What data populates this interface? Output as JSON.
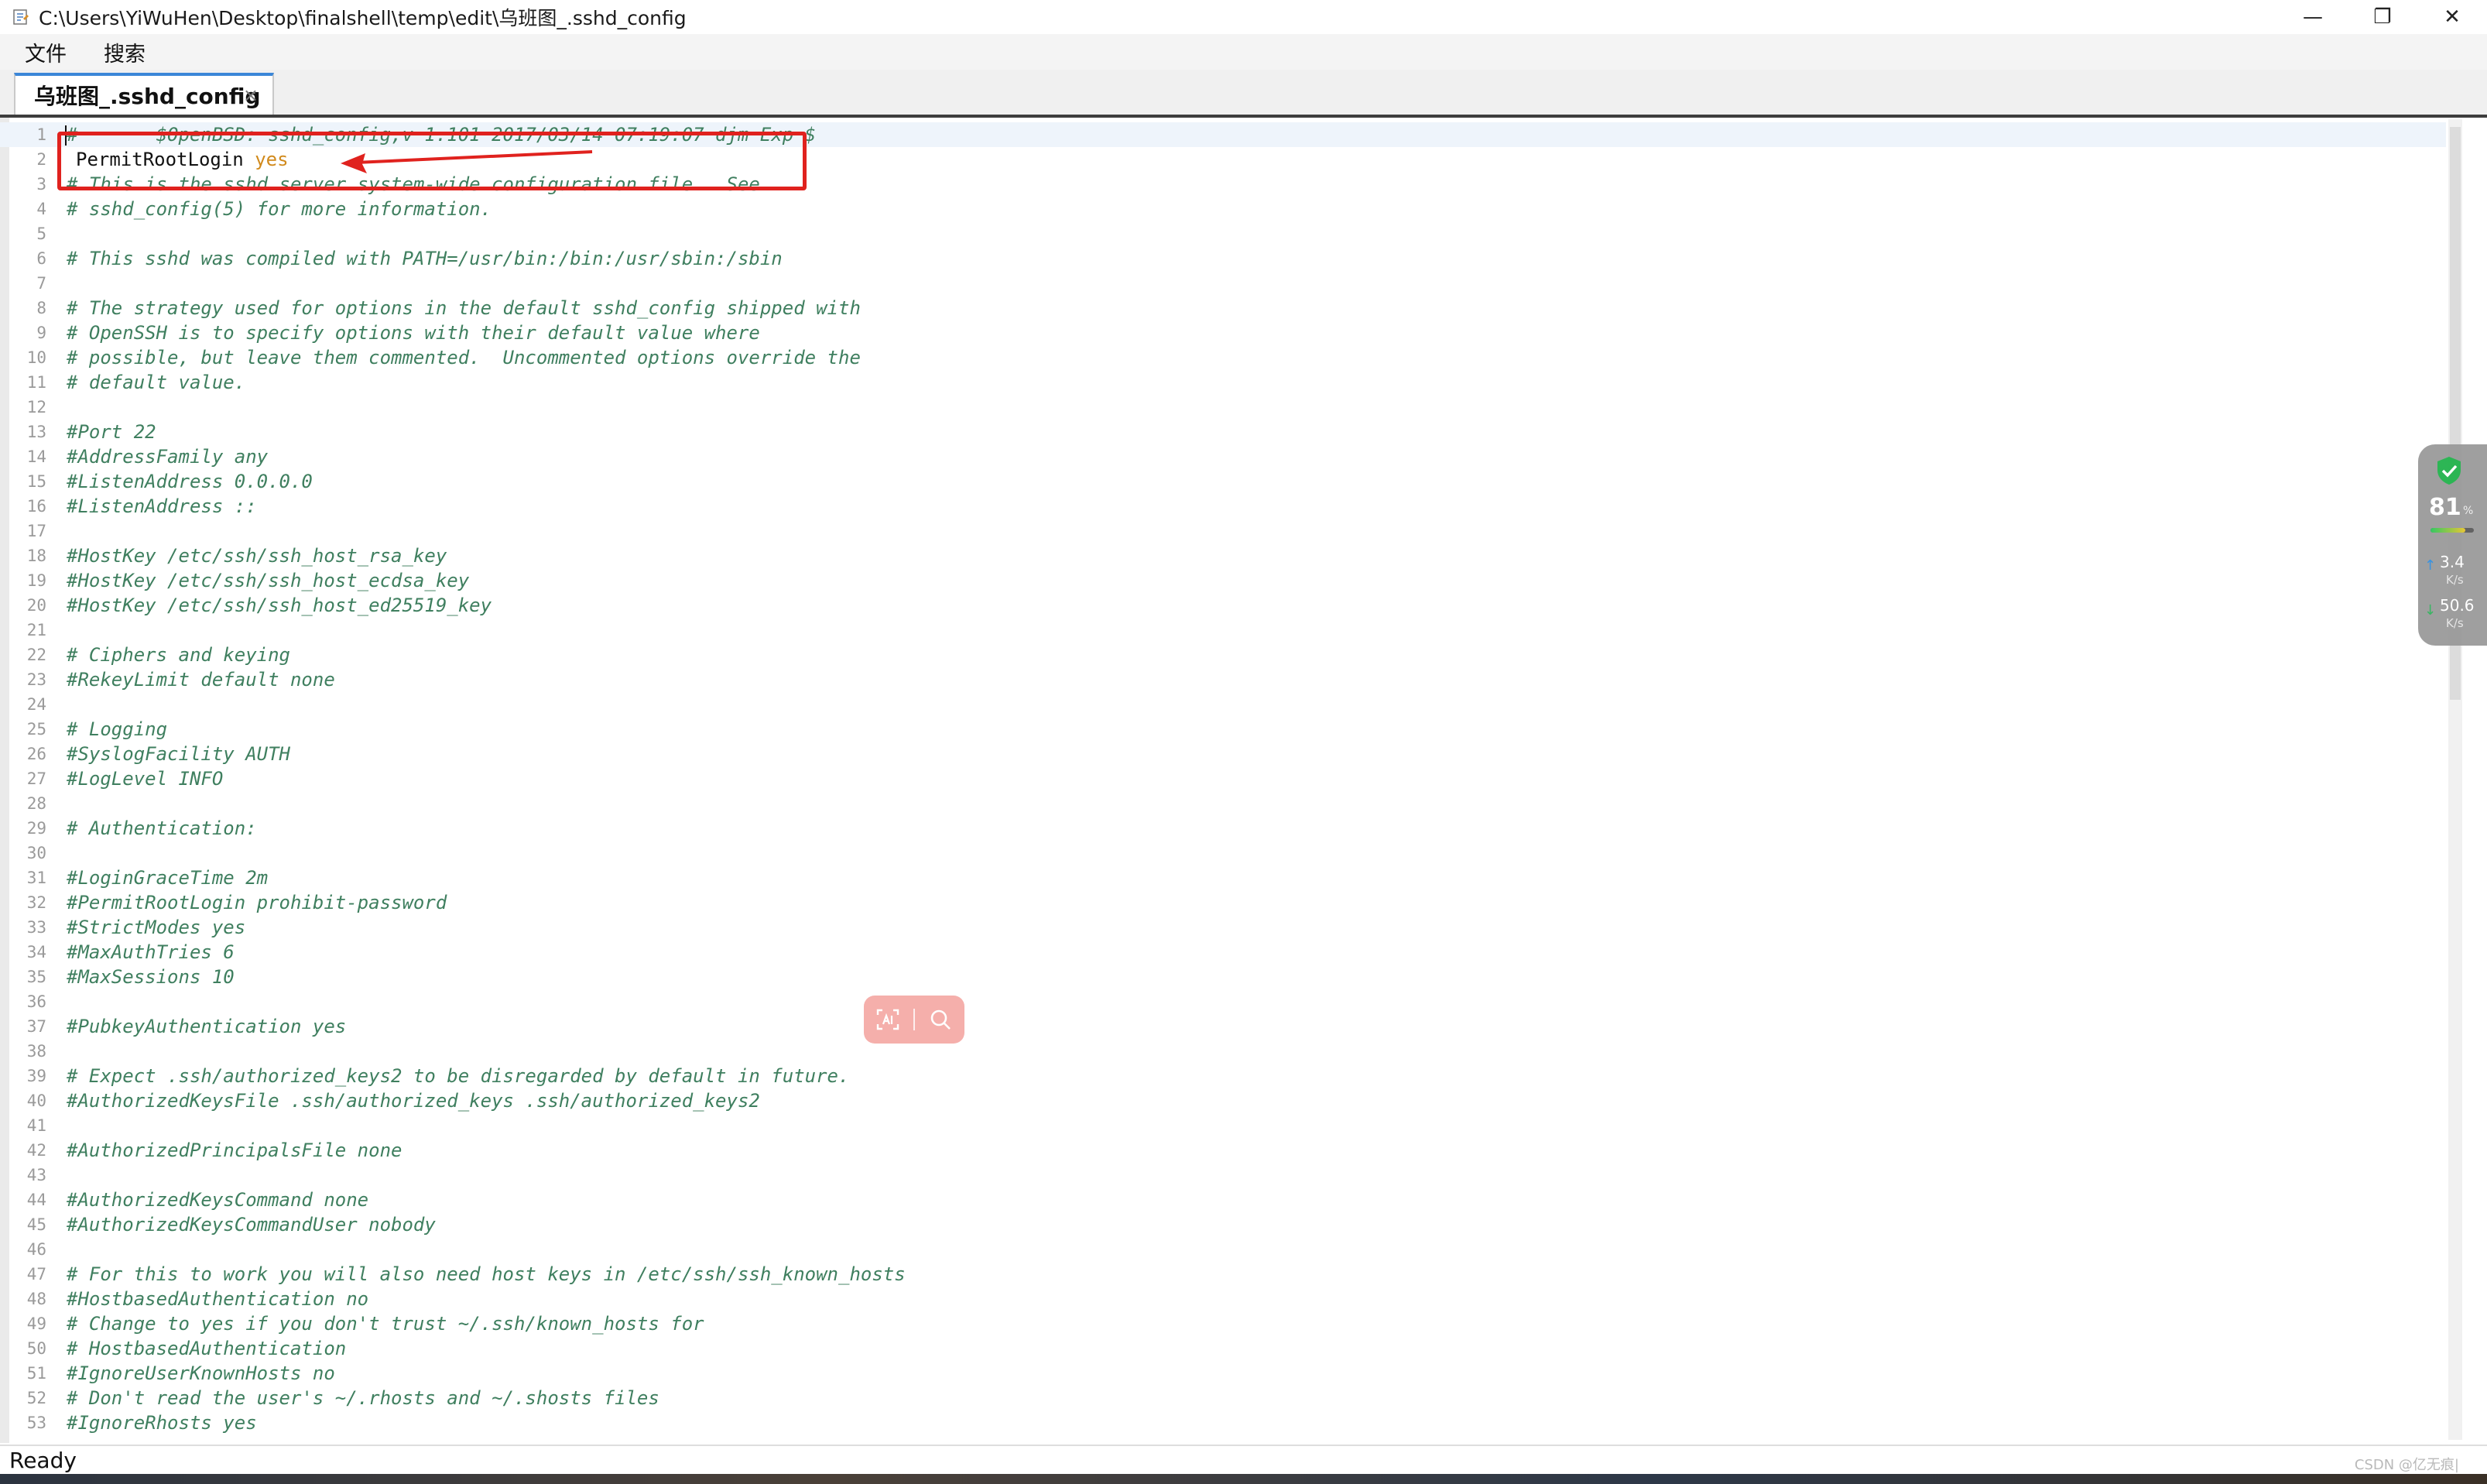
{
  "window": {
    "title": "C:\\Users\\YiWuHen\\Desktop\\finalshell\\temp\\edit\\乌班图_.sshd_config",
    "minimize": "—",
    "maximize": "❐",
    "close": "✕"
  },
  "menu": [
    "文件",
    "搜索"
  ],
  "tab": {
    "label": "乌班图_.sshd_config",
    "close": "×"
  },
  "editor": {
    "lines": [
      {
        "n": "1",
        "text": "#\t$OpenBSD: sshd_config,v 1.101 2017/03/14 07:19:07 djm Exp $"
      },
      {
        "n": "2",
        "text": "PermitRootLogin ",
        "value": "yes"
      },
      {
        "n": "3",
        "text": "# This is the sshd server system-wide configuration file.  See"
      },
      {
        "n": "4",
        "text": "# sshd_config(5) for more information."
      },
      {
        "n": "5",
        "text": ""
      },
      {
        "n": "6",
        "text": "# This sshd was compiled with PATH=/usr/bin:/bin:/usr/sbin:/sbin"
      },
      {
        "n": "7",
        "text": ""
      },
      {
        "n": "8",
        "text": "# The strategy used for options in the default sshd_config shipped with"
      },
      {
        "n": "9",
        "text": "# OpenSSH is to specify options with their default value where"
      },
      {
        "n": "10",
        "text": "# possible, but leave them commented.  Uncommented options override the"
      },
      {
        "n": "11",
        "text": "# default value."
      },
      {
        "n": "12",
        "text": ""
      },
      {
        "n": "13",
        "text": "#Port 22"
      },
      {
        "n": "14",
        "text": "#AddressFamily any"
      },
      {
        "n": "15",
        "text": "#ListenAddress 0.0.0.0"
      },
      {
        "n": "16",
        "text": "#ListenAddress ::"
      },
      {
        "n": "17",
        "text": ""
      },
      {
        "n": "18",
        "text": "#HostKey /etc/ssh/ssh_host_rsa_key"
      },
      {
        "n": "19",
        "text": "#HostKey /etc/ssh/ssh_host_ecdsa_key"
      },
      {
        "n": "20",
        "text": "#HostKey /etc/ssh/ssh_host_ed25519_key"
      },
      {
        "n": "21",
        "text": ""
      },
      {
        "n": "22",
        "text": "# Ciphers and keying"
      },
      {
        "n": "23",
        "text": "#RekeyLimit default none"
      },
      {
        "n": "24",
        "text": ""
      },
      {
        "n": "25",
        "text": "# Logging"
      },
      {
        "n": "26",
        "text": "#SyslogFacility AUTH"
      },
      {
        "n": "27",
        "text": "#LogLevel INFO"
      },
      {
        "n": "28",
        "text": ""
      },
      {
        "n": "29",
        "text": "# Authentication:"
      },
      {
        "n": "30",
        "text": ""
      },
      {
        "n": "31",
        "text": "#LoginGraceTime 2m"
      },
      {
        "n": "32",
        "text": "#PermitRootLogin prohibit-password"
      },
      {
        "n": "33",
        "text": "#StrictModes yes"
      },
      {
        "n": "34",
        "text": "#MaxAuthTries 6"
      },
      {
        "n": "35",
        "text": "#MaxSessions 10"
      },
      {
        "n": "36",
        "text": ""
      },
      {
        "n": "37",
        "text": "#PubkeyAuthentication yes"
      },
      {
        "n": "38",
        "text": ""
      },
      {
        "n": "39",
        "text": "# Expect .ssh/authorized_keys2 to be disregarded by default in future."
      },
      {
        "n": "40",
        "text": "#AuthorizedKeysFile .ssh/authorized_keys .ssh/authorized_keys2"
      },
      {
        "n": "41",
        "text": ""
      },
      {
        "n": "42",
        "text": "#AuthorizedPrincipalsFile none"
      },
      {
        "n": "43",
        "text": ""
      },
      {
        "n": "44",
        "text": "#AuthorizedKeysCommand none"
      },
      {
        "n": "45",
        "text": "#AuthorizedKeysCommandUser nobody"
      },
      {
        "n": "46",
        "text": ""
      },
      {
        "n": "47",
        "text": "# For this to work you will also need host keys in /etc/ssh/ssh_known_hosts"
      },
      {
        "n": "48",
        "text": "#HostbasedAuthentication no"
      },
      {
        "n": "49",
        "text": "# Change to yes if you don't trust ~/.ssh/known_hosts for"
      },
      {
        "n": "50",
        "text": "# HostbasedAuthentication"
      },
      {
        "n": "51",
        "text": "#IgnoreUserKnownHosts no"
      },
      {
        "n": "52",
        "text": "# Don't read the user's ~/.rhosts and ~/.shosts files"
      },
      {
        "n": "53",
        "text": "#IgnoreRhosts yes"
      }
    ]
  },
  "net_monitor": {
    "score": "81",
    "score_unit": "%",
    "score_fraction": 0.81,
    "upload": "3.4",
    "upload_unit": "K/s",
    "download": "50.6",
    "download_unit": "K/s"
  },
  "status": {
    "text": "Ready"
  },
  "watermark": "CSDN @亿无痕|",
  "colors": {
    "comment": "#3f7f5f",
    "value": "#d18a1c",
    "annotation": "#e0221e",
    "tab_accent": "#3b86d8"
  }
}
